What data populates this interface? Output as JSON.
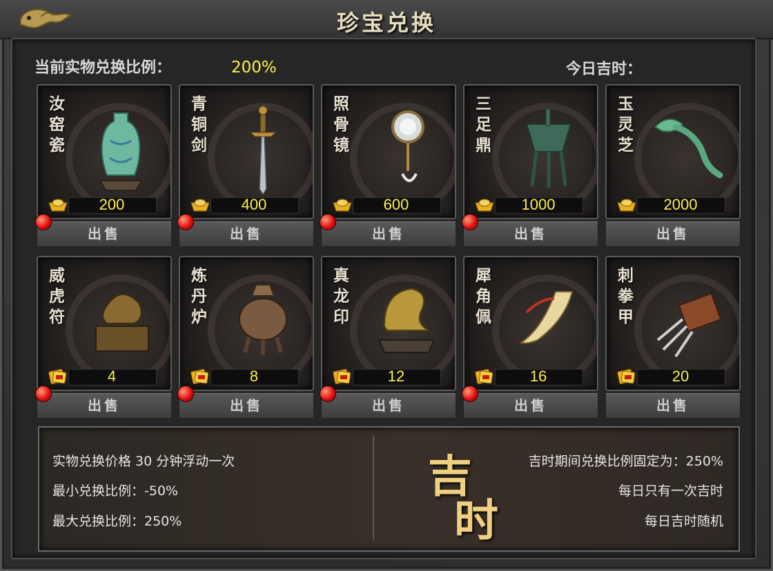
{
  "window": {
    "title": "珍宝兑换"
  },
  "header": {
    "rate_label": "当前实物兑换比例：",
    "rate_value": "200%",
    "lucky_label": "今日吉时：",
    "lucky_value": ""
  },
  "sell_label": "出售",
  "currency_icons": {
    "gold": "gold-ingot-icon",
    "ticket": "gold-ticket-icon"
  },
  "items": [
    {
      "name": "汝窑瓷",
      "price": "200",
      "currency": "gold",
      "icon": "porcelain-vase"
    },
    {
      "name": "青铜剑",
      "price": "400",
      "currency": "gold",
      "icon": "bronze-sword"
    },
    {
      "name": "照骨镜",
      "price": "600",
      "currency": "gold",
      "icon": "bone-mirror"
    },
    {
      "name": "三足鼎",
      "price": "1000",
      "currency": "gold",
      "icon": "tripod-cauldron"
    },
    {
      "name": "玉灵芝",
      "price": "2000",
      "currency": "gold",
      "icon": "jade-lingzhi"
    },
    {
      "name": "威虎符",
      "price": "4",
      "currency": "ticket",
      "icon": "tiger-tally"
    },
    {
      "name": "炼丹炉",
      "price": "8",
      "currency": "ticket",
      "icon": "alchemy-furnace"
    },
    {
      "name": "真龙印",
      "price": "12",
      "currency": "ticket",
      "icon": "dragon-seal"
    },
    {
      "name": "犀角佩",
      "price": "16",
      "currency": "ticket",
      "icon": "rhino-horn"
    },
    {
      "name": "刺拳甲",
      "price": "20",
      "currency": "ticket",
      "icon": "claw-gauntlet"
    }
  ],
  "info": {
    "left": [
      "实物兑换价格 30 分钟浮动一次",
      "最小兑换比例：-50%",
      "最大兑换比例：250%"
    ],
    "ji_char1": "吉",
    "ji_char2": "时",
    "right": [
      "吉时期间兑换比例固定为：250%",
      "每日只有一次吉时",
      "每日吉时随机"
    ]
  }
}
